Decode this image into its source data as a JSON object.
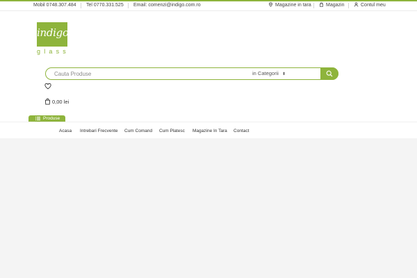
{
  "topbar": {
    "phone_mobile": "Mobil 0748.307.484",
    "phone_tel": "Tel 0770.331.525",
    "email": "Email: comenzi@indigo.com.ro",
    "stores_country": "Magazine in tara",
    "shop": "Magazin",
    "account": "Contul meu"
  },
  "logo": {
    "word": "indigo",
    "sub": "glass"
  },
  "search": {
    "placeholder": "Cauta Produse",
    "category_selected": "in Categorii",
    "category_arrows": "⬍"
  },
  "cart": {
    "total": "0,00 lei"
  },
  "produse": {
    "label": "Produse"
  },
  "nav": {
    "items": [
      "Acasa",
      "Intrebari Frecvente",
      "Cum Comand",
      "Cum Platesc",
      "Magazine In Tara",
      "Contact"
    ]
  },
  "colors": {
    "accent": "#8eb43c",
    "grey_area": "#f4f4f4"
  },
  "icons": [
    "location-pin-icon",
    "shopping-bag-icon",
    "user-icon",
    "search-icon",
    "heart-icon",
    "cart-bag-icon",
    "list-icon"
  ]
}
